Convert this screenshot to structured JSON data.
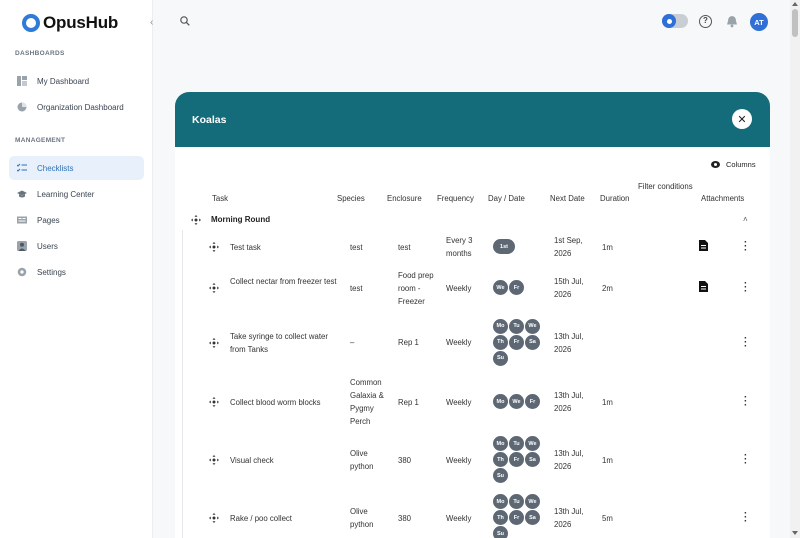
{
  "app": {
    "name": "OpusHub"
  },
  "sidebar": {
    "sections": [
      {
        "label": "DASHBOARDS",
        "items": [
          {
            "label": "My Dashboard",
            "icon": "dashboard-icon"
          },
          {
            "label": "Organization Dashboard",
            "icon": "org-dashboard-icon"
          }
        ]
      },
      {
        "label": "MANAGEMENT",
        "items": [
          {
            "label": "Checklists",
            "icon": "checklist-icon",
            "active": true
          },
          {
            "label": "Learning Center",
            "icon": "graduation-cap-icon"
          },
          {
            "label": "Pages",
            "icon": "pages-icon"
          },
          {
            "label": "Users",
            "icon": "user-icon"
          },
          {
            "label": "Settings",
            "icon": "gear-icon"
          }
        ]
      }
    ]
  },
  "topbar": {
    "avatar_initials": "AT"
  },
  "panel": {
    "title": "Koalas",
    "columns_label": "Columns",
    "headers": {
      "task": "Task",
      "species": "Species",
      "enclosure": "Enclosure",
      "frequency": "Frequency",
      "day_date": "Day / Date",
      "next_date": "Next Date",
      "duration": "Duration",
      "filter_conditions": "Filter conditions",
      "attachments": "Attachments"
    },
    "group": {
      "label": "Morning Round"
    },
    "rows": [
      {
        "task": "Test task",
        "species": "test",
        "enclosure": "test",
        "frequency": "Every 3 months",
        "days": [
          "1st"
        ],
        "next_date": "1st Sep, 2026",
        "duration": "1m",
        "attachment": true
      },
      {
        "task": "Collect nectar from freezer test",
        "species": "test",
        "enclosure": "Food prep room - Freezer",
        "frequency": "Weekly",
        "days": [
          "We",
          "Fr"
        ],
        "next_date": "15th Jul, 2026",
        "duration": "2m",
        "attachment": true
      },
      {
        "task": "Take syringe to collect water from Tanks",
        "species": "–",
        "enclosure": "Rep 1",
        "frequency": "Weekly",
        "days": [
          "Mo",
          "Tu",
          "We",
          "Th",
          "Fr",
          "Sa",
          "Su"
        ],
        "next_date": "13th Jul, 2026",
        "duration": "",
        "attachment": false
      },
      {
        "task": "Collect blood worm blocks",
        "species": "Common Galaxia & Pygmy Perch",
        "enclosure": "Rep 1",
        "frequency": "Weekly",
        "days": [
          "Mo",
          "We",
          "Fr"
        ],
        "next_date": "13th Jul, 2026",
        "duration": "1m",
        "attachment": false
      },
      {
        "task": "Visual check",
        "species": "Olive python",
        "enclosure": "380",
        "frequency": "Weekly",
        "days": [
          "Mo",
          "Tu",
          "We",
          "Th",
          "Fr",
          "Sa",
          "Su"
        ],
        "next_date": "13th Jul, 2026",
        "duration": "1m",
        "attachment": false
      },
      {
        "task": "Rake / poo collect",
        "species": "Olive python",
        "enclosure": "380",
        "frequency": "Weekly",
        "days": [
          "Mo",
          "Tu",
          "We",
          "Th",
          "Fr",
          "Sa",
          "Su"
        ],
        "next_date": "13th Jul, 2026",
        "duration": "5m",
        "attachment": false
      }
    ]
  },
  "colors": {
    "brand": "#2f7bd8",
    "header": "#146c7b",
    "active_bg": "#e8f1fb",
    "day_chip": "#5d6874"
  }
}
